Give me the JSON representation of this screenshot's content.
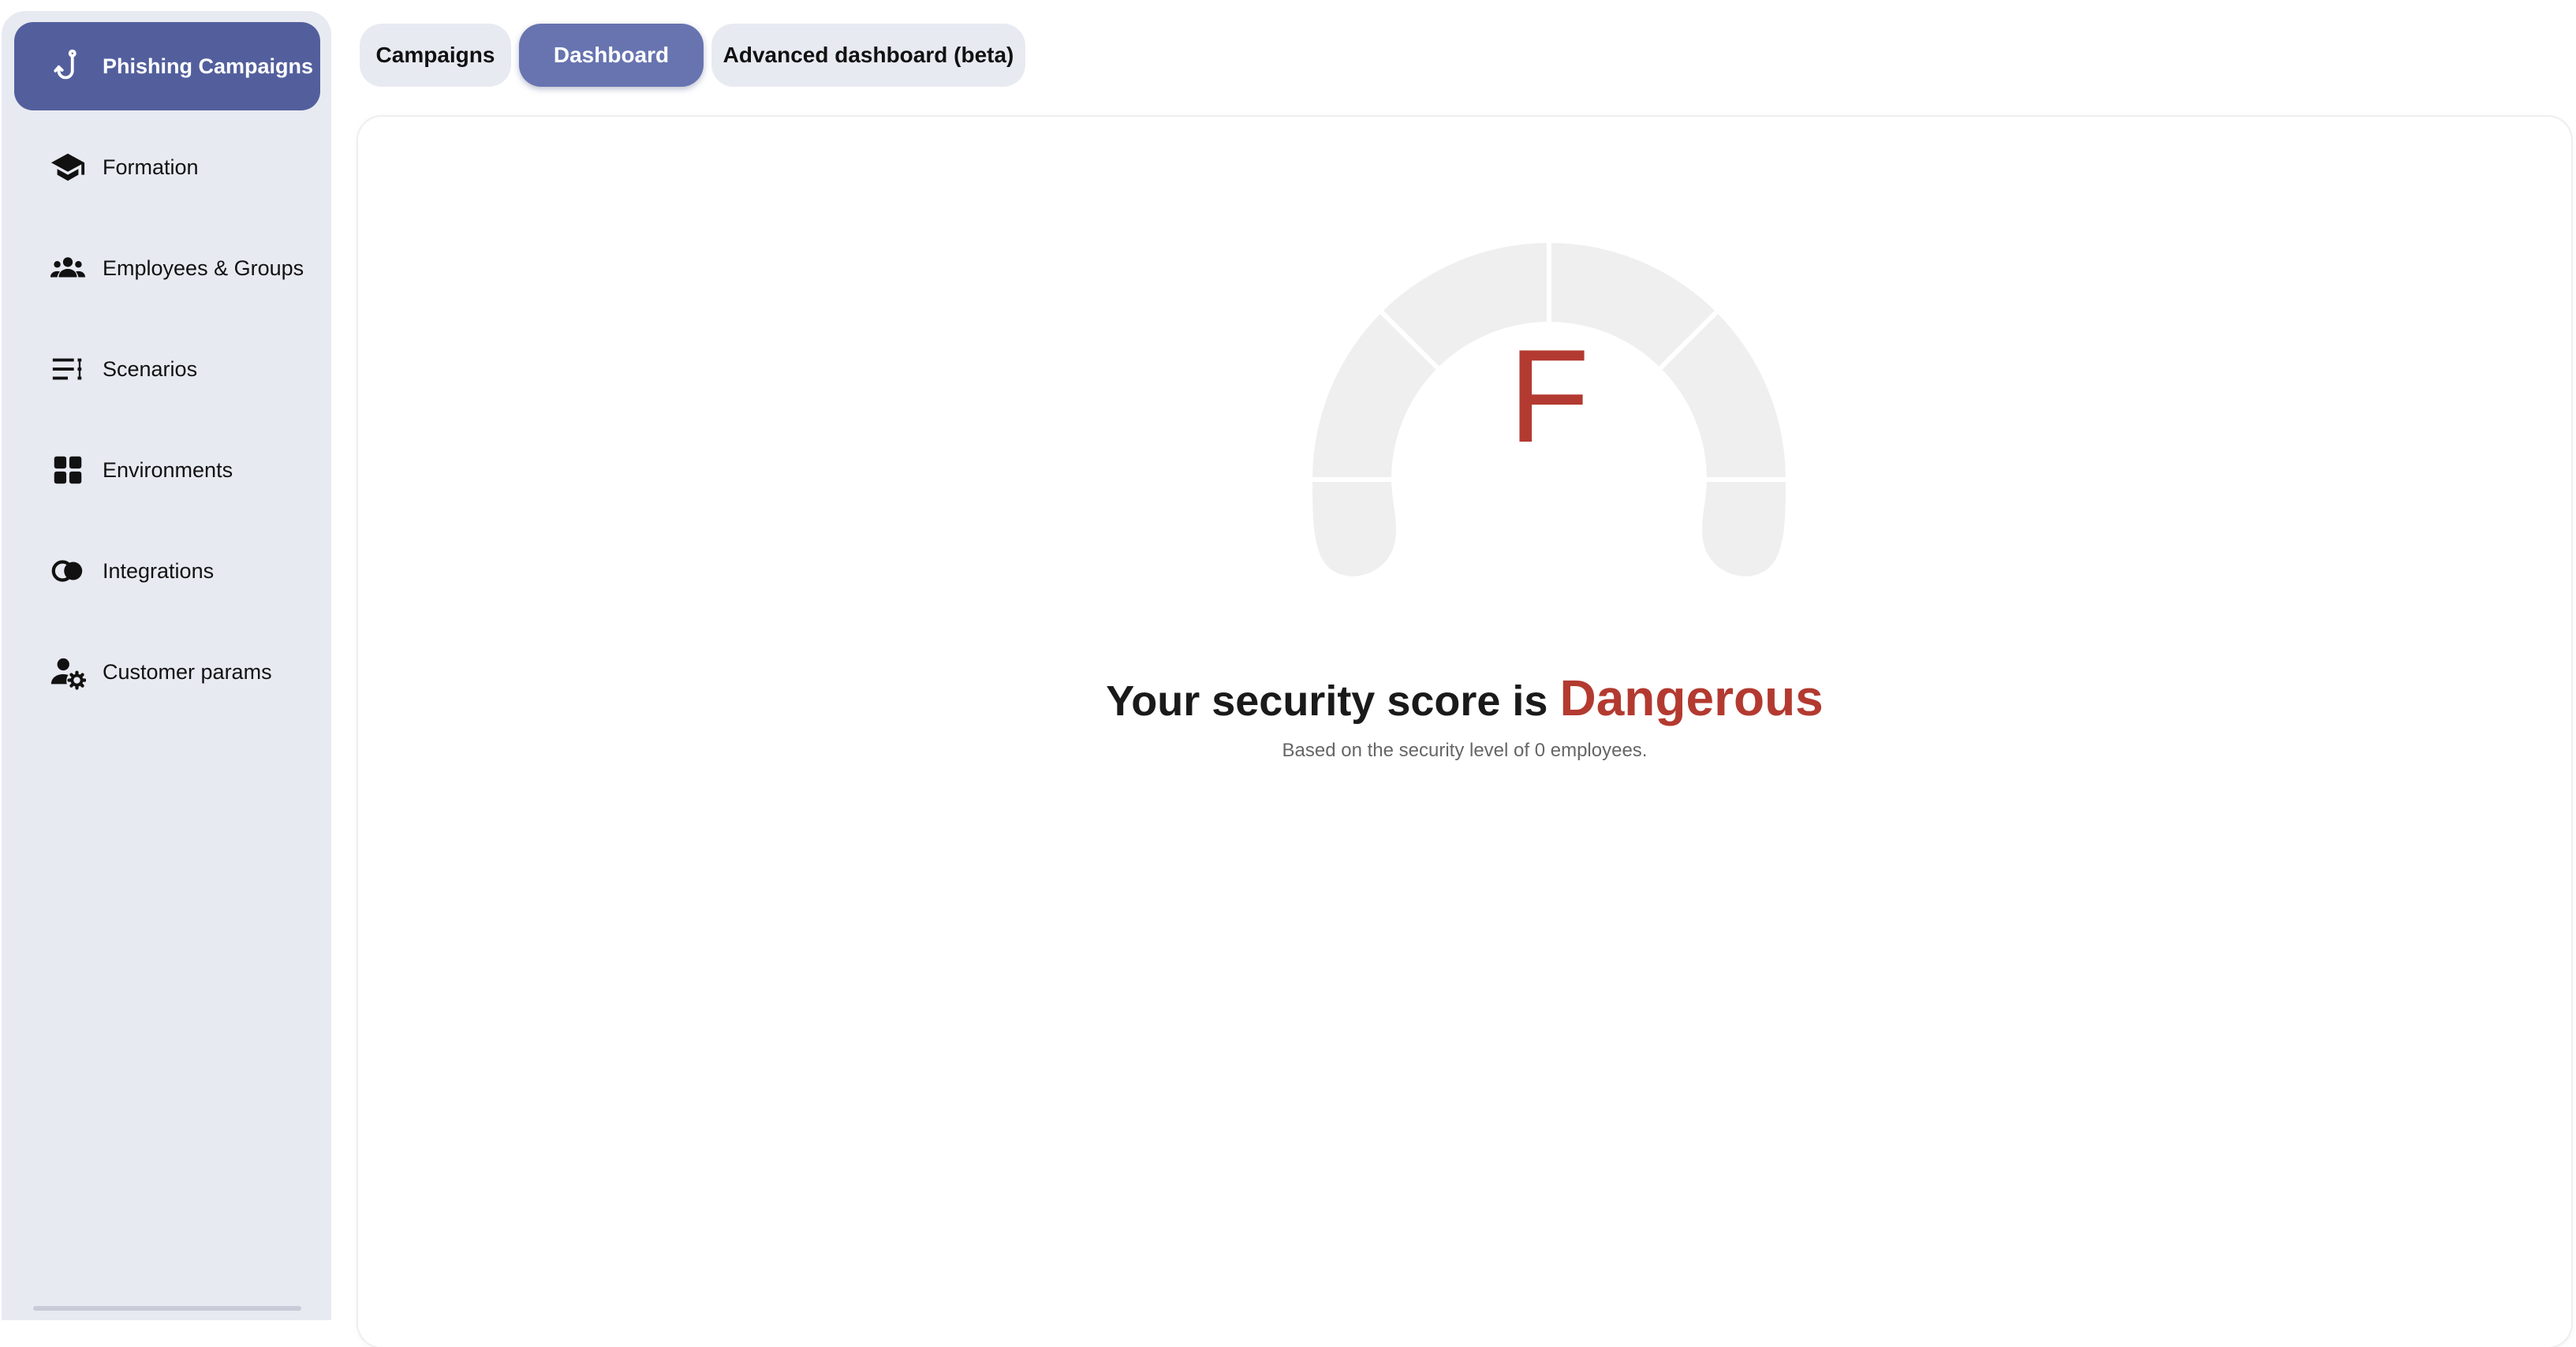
{
  "sidebar": {
    "items": [
      {
        "label": "Phishing Campaigns",
        "icon": "hook-icon"
      },
      {
        "label": "Formation",
        "icon": "graduation-cap-icon"
      },
      {
        "label": "Employees & Groups",
        "icon": "people-group-icon"
      },
      {
        "label": "Scenarios",
        "icon": "list-icon"
      },
      {
        "label": "Environments",
        "icon": "grid-icon"
      },
      {
        "label": "Integrations",
        "icon": "overlapping-circles-icon"
      },
      {
        "label": "Customer params",
        "icon": "user-gear-icon"
      }
    ]
  },
  "tabs": [
    {
      "label": "Campaigns"
    },
    {
      "label": "Dashboard"
    },
    {
      "label": "Advanced dashboard (beta)"
    }
  ],
  "dashboard": {
    "grade": "F",
    "score_prefix": "Your security score is",
    "score_level": "Dangerous",
    "subtitle": "Based on the security level of 0 employees."
  },
  "colors": {
    "accent": "#535f9d",
    "tab_active": "#6774b0",
    "danger": "#b33a30",
    "gauge_empty": "#efefef",
    "sidebar_bg": "#e8eaf2"
  }
}
